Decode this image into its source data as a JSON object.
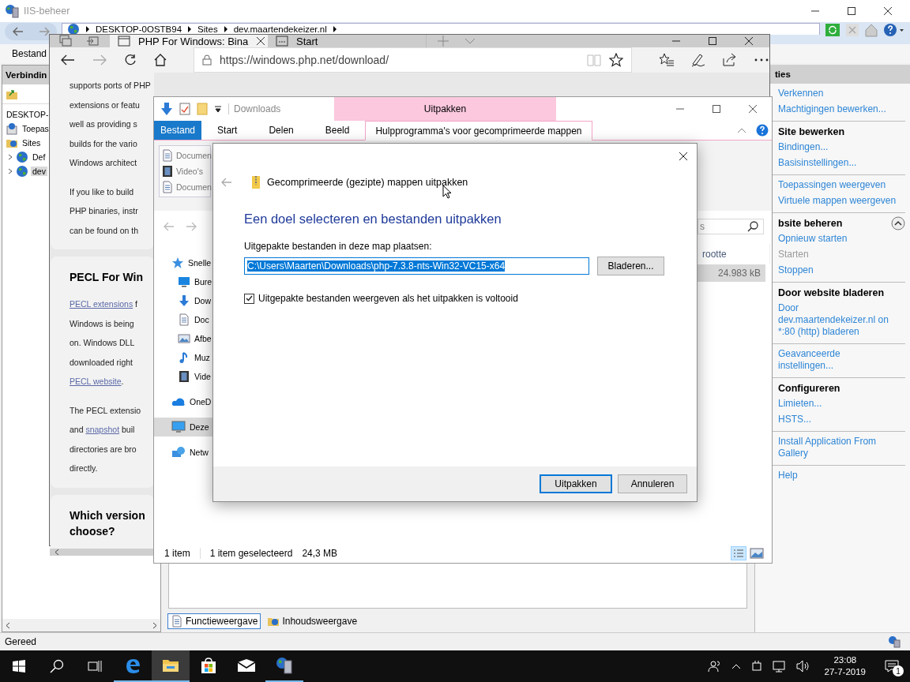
{
  "iis": {
    "title": "IIS-beheer",
    "breadcrumb": [
      "DESKTOP-0OSTB94",
      "Sites",
      "dev.maartendekeizer.nl"
    ],
    "menu": [
      "Bestand"
    ],
    "connections": {
      "header": "Verbindin",
      "tree": [
        {
          "label": "DESKTOP-",
          "selected": false,
          "children": [
            {
              "label": "Toepas",
              "kind": "pool",
              "selected": false
            },
            {
              "label": "Sites",
              "kind": "sites",
              "selected": false,
              "children": [
                {
                  "label": "Def",
                  "kind": "site",
                  "expanded": false,
                  "selected": false
                },
                {
                  "label": "dev",
                  "kind": "site",
                  "expanded": false,
                  "selected": true
                }
              ]
            }
          ]
        }
      ]
    },
    "actions": {
      "header": "ties",
      "groups": [
        {
          "items": [
            {
              "label": "Verkennen",
              "disabled": false
            },
            {
              "label": "Machtigingen bewerken...",
              "disabled": false
            }
          ]
        },
        {
          "heading": "Site bewerken",
          "items": [
            {
              "label": "Bindingen...",
              "disabled": false
            },
            {
              "label": "Basisinstellingen...",
              "disabled": false
            }
          ]
        },
        {
          "items": [
            {
              "label": "Toepassingen weergeven",
              "disabled": false
            },
            {
              "label": "Virtuele mappen weergeven",
              "disabled": false
            }
          ]
        },
        {
          "heading": "bsite beheren",
          "collapse_button": true,
          "items": [
            {
              "label": "Opnieuw starten",
              "disabled": false
            },
            {
              "label": "Starten",
              "disabled": true
            },
            {
              "label": "Stoppen",
              "disabled": false
            }
          ]
        },
        {
          "heading": "Door website bladeren",
          "items": [
            {
              "label": "Door dev.maartendekeizer.nl on *:80 (http) bladeren",
              "disabled": false
            }
          ]
        },
        {
          "items": [
            {
              "label": "Geavanceerde instellingen...",
              "disabled": false
            }
          ]
        },
        {
          "heading": "Configureren",
          "items": [
            {
              "label": "Limieten...",
              "disabled": false
            },
            {
              "label": "HSTS...",
              "disabled": false
            }
          ]
        },
        {
          "items": [
            {
              "label": "Install Application From Gallery",
              "disabled": false
            }
          ]
        },
        {
          "items": [
            {
              "label": "Help",
              "disabled": false
            }
          ]
        }
      ]
    },
    "views": [
      {
        "label": "Functieweergave",
        "selected": true
      },
      {
        "label": "Inhoudsweergave",
        "selected": false
      }
    ],
    "status": "Gereed"
  },
  "edge": {
    "tabs": [
      {
        "label": "PHP For Windows: Bina",
        "selected": true
      },
      {
        "label": "Start",
        "selected": false
      }
    ],
    "url": "https://windows.php.net/download/",
    "cards": [
      {
        "blocks": [
          {
            "kind": "text",
            "lines": [
              "supports ports of PHP",
              "extensions or featu",
              "well as providing s",
              "builds for the vario",
              "Windows architect"
            ]
          },
          {
            "kind": "text",
            "lines": [
              "If you like to build",
              "PHP binaries, instr",
              "can be found on th"
            ]
          }
        ]
      },
      {
        "blocks": [
          {
            "kind": "heading",
            "lines": [
              "PECL For Win"
            ]
          },
          {
            "kind": "text",
            "lines": [
              [
                {
                  "text": "PECL extensions",
                  "link": true
                },
                " f"
              ],
              "Windows is being",
              "on. Windows DLL",
              "downloaded right",
              [
                {
                  "text": "PECL website",
                  "link": true
                },
                "."
              ]
            ]
          },
          {
            "kind": "text",
            "lines": [
              "The PECL extensio",
              [
                "and ",
                {
                  "text": "snapshot",
                  "link": true
                },
                " buil"
              ],
              "directories are bro",
              "directly."
            ]
          }
        ]
      },
      {
        "blocks": [
          {
            "kind": "heading",
            "lines": [
              "Which version",
              "choose?"
            ]
          }
        ]
      }
    ]
  },
  "explorer": {
    "title": "Downloads",
    "context_label": "Uitpakken",
    "ribbon_tabs": [
      {
        "label": "Bestand",
        "kind": "file",
        "selected": false
      },
      {
        "label": "Start",
        "kind": "tab",
        "selected": false
      },
      {
        "label": "Delen",
        "kind": "tab",
        "selected": false
      },
      {
        "label": "Beeld",
        "kind": "tab",
        "selected": false
      },
      {
        "label": "Hulpprogramma's voor gecomprimeerde mappen",
        "kind": "context",
        "selected": true
      }
    ],
    "recent": [
      {
        "label": "Documen",
        "kind": "doc"
      },
      {
        "label": "Video's",
        "kind": "video"
      },
      {
        "label": "Documen",
        "kind": "doc"
      }
    ],
    "search": {
      "placeholder": "s"
    },
    "nav": [
      {
        "label": "Snelle",
        "kind": "star",
        "selected": false,
        "children": [
          {
            "label": "Bure",
            "kind": "desktop",
            "selected": false
          },
          {
            "label": "Dow",
            "kind": "download",
            "selected": false
          },
          {
            "label": "Doc",
            "kind": "doc",
            "selected": false
          },
          {
            "label": "Afbe",
            "kind": "picture",
            "selected": false
          },
          {
            "label": "Muz",
            "kind": "music",
            "selected": false
          },
          {
            "label": "Vide",
            "kind": "video",
            "selected": false
          }
        ]
      },
      {
        "label": "OneD",
        "kind": "cloud",
        "selected": false
      },
      {
        "label": "Deze",
        "kind": "pc",
        "selected": true
      },
      {
        "label": "Netw",
        "kind": "network",
        "selected": false
      }
    ],
    "column": "rootte",
    "file_size": "24.983 kB",
    "status": [
      "1 item",
      "1 item geselecteerd",
      "24,3 MB"
    ]
  },
  "dialog": {
    "title": "Gecomprimeerde (gezipte) mappen uitpakken",
    "heading": "Een doel selecteren en bestanden uitpakken",
    "field_label": "Uitgepakte bestanden in deze map plaatsen:",
    "path": "C:\\Users\\Maarten\\Downloads\\php-7.3.8-nts-Win32-VC15-x64",
    "browse": "Bladeren...",
    "show_files": {
      "label": "Uitgepakte bestanden weergeven als het uitpakken is voltooid",
      "checked": true
    },
    "buttons": [
      {
        "label": "Uitpakken",
        "default": true
      },
      {
        "label": "Annuleren",
        "default": false
      }
    ]
  },
  "taskbar": {
    "apps": [
      {
        "kind": "edge",
        "running": true,
        "active": false
      },
      {
        "kind": "explorer",
        "running": true,
        "active": true
      },
      {
        "kind": "store",
        "running": false,
        "active": false
      },
      {
        "kind": "mail",
        "running": false,
        "active": false
      },
      {
        "kind": "iis",
        "running": true,
        "active": false
      }
    ],
    "time": "23:08",
    "date": "27-7-2019",
    "notifications": "1"
  }
}
